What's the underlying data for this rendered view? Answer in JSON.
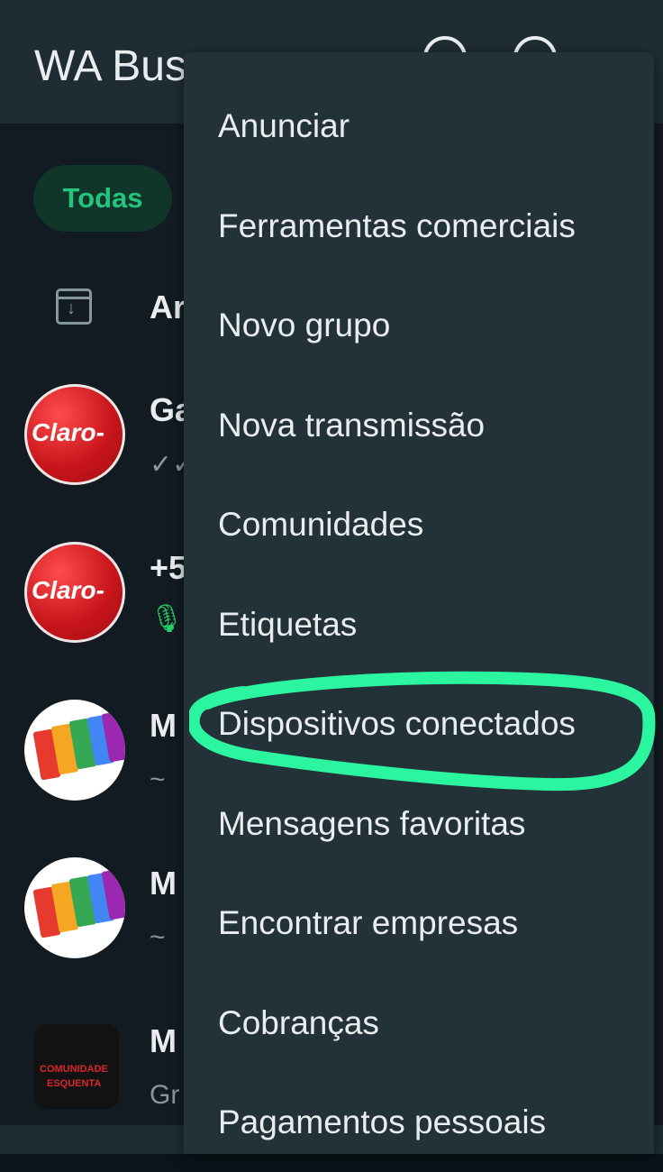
{
  "app": {
    "title": "WA Bus"
  },
  "filters": {
    "selected": "Todas"
  },
  "archived": {
    "label": "Ar"
  },
  "chats": [
    {
      "name": "Ga",
      "preview": "✓✓",
      "avatar": "claro"
    },
    {
      "name": "+5",
      "preview": "🎙",
      "avatar": "claro"
    },
    {
      "name": "M",
      "preview": "~",
      "avatar": "sims"
    },
    {
      "name": "M",
      "preview": "~",
      "avatar": "sims"
    },
    {
      "name": "M",
      "preview": "Gr",
      "avatar": "comunidade"
    }
  ],
  "avatars": {
    "claro_label": "Claro-",
    "comunidade_line1": "COMUNIDADE",
    "comunidade_line2": "ESQUENTA"
  },
  "menu": {
    "items": [
      "Anunciar",
      "Ferramentas comerciais",
      "Novo grupo",
      "Nova transmissão",
      "Comunidades",
      "Etiquetas",
      "Dispositivos conectados",
      "Mensagens favoritas",
      "Encontrar empresas",
      "Cobranças",
      "Pagamentos pessoais"
    ],
    "highlighted_item": "Dispositivos conectados"
  },
  "colors": {
    "app_bar": "#1f2c34",
    "background": "#111b21",
    "menu_background": "#233138",
    "accent_green": "#25d366",
    "highlight_stroke": "#2cf5a0"
  }
}
